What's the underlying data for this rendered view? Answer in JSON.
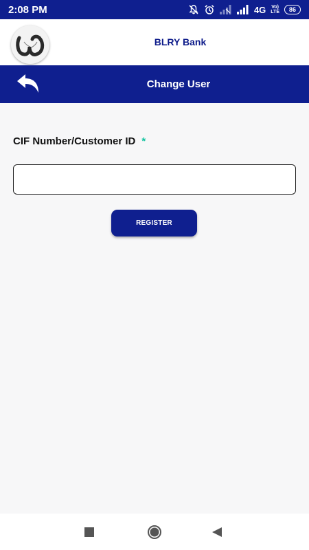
{
  "status_bar": {
    "time": "2:08 PM",
    "network": "4G",
    "volte_top": "Vo)",
    "volte_bottom": "LTE",
    "battery": "86"
  },
  "header": {
    "app_title": "BLRY Bank"
  },
  "toolbar": {
    "title": "Change User"
  },
  "form": {
    "cif_label": "CIF Number/Customer ID",
    "required_marker": "*",
    "cif_value": "",
    "cif_placeholder": "",
    "register_label": "REGISTER"
  },
  "colors": {
    "primary": "#0f1f8f",
    "required": "#13c3a0",
    "background": "#f7f7f8"
  },
  "icons": {
    "back": "back-arrow-icon",
    "nav_recents": "square-icon",
    "nav_home": "circle-icon",
    "nav_back": "triangle-back-icon"
  }
}
